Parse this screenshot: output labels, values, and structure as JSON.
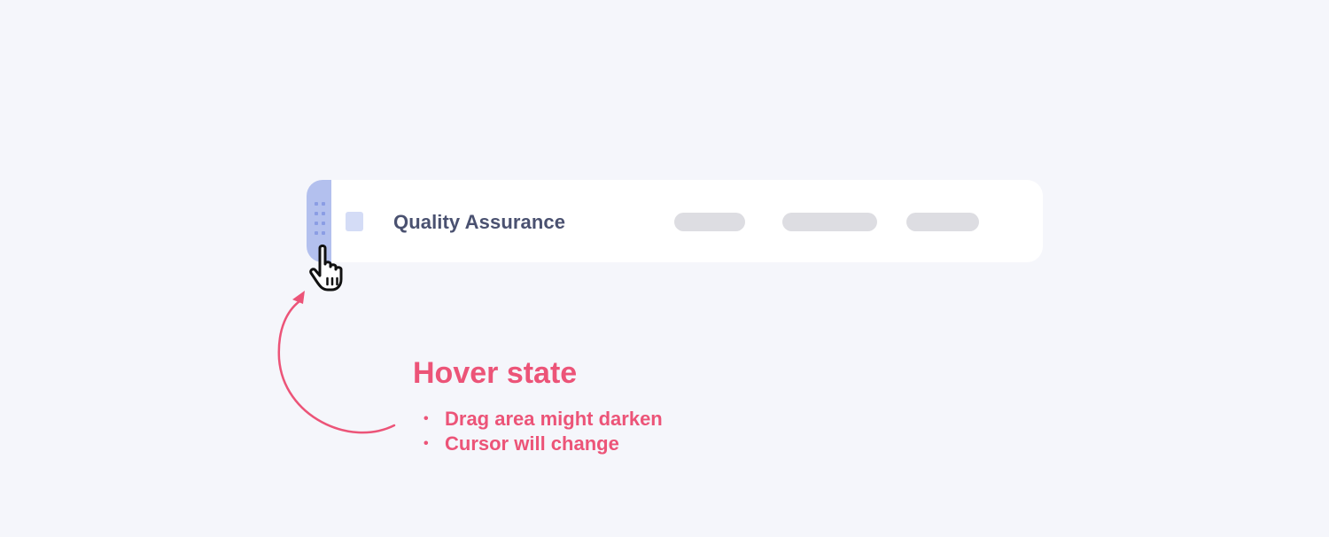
{
  "row": {
    "title": "Quality Assurance",
    "placeholder_pills": 3
  },
  "annotation": {
    "title": "Hover state",
    "bullets": [
      "Drag area might darken",
      "Cursor will change"
    ],
    "bullet_glyph": "•"
  },
  "colors": {
    "background": "#f5f6fb",
    "card": "#ffffff",
    "drag_handle_hover": "#b3c0ee",
    "drag_dots": "#8b9de4",
    "checkbox": "#d4dcf6",
    "title_text": "#4a5170",
    "pill_placeholder": "#dddde2",
    "annotation_accent": "#ec5478"
  },
  "icons": {
    "drag": "drag-dots-icon",
    "cursor": "hand-pointer-cursor-icon",
    "arrow": "curved-arrow-icon"
  }
}
